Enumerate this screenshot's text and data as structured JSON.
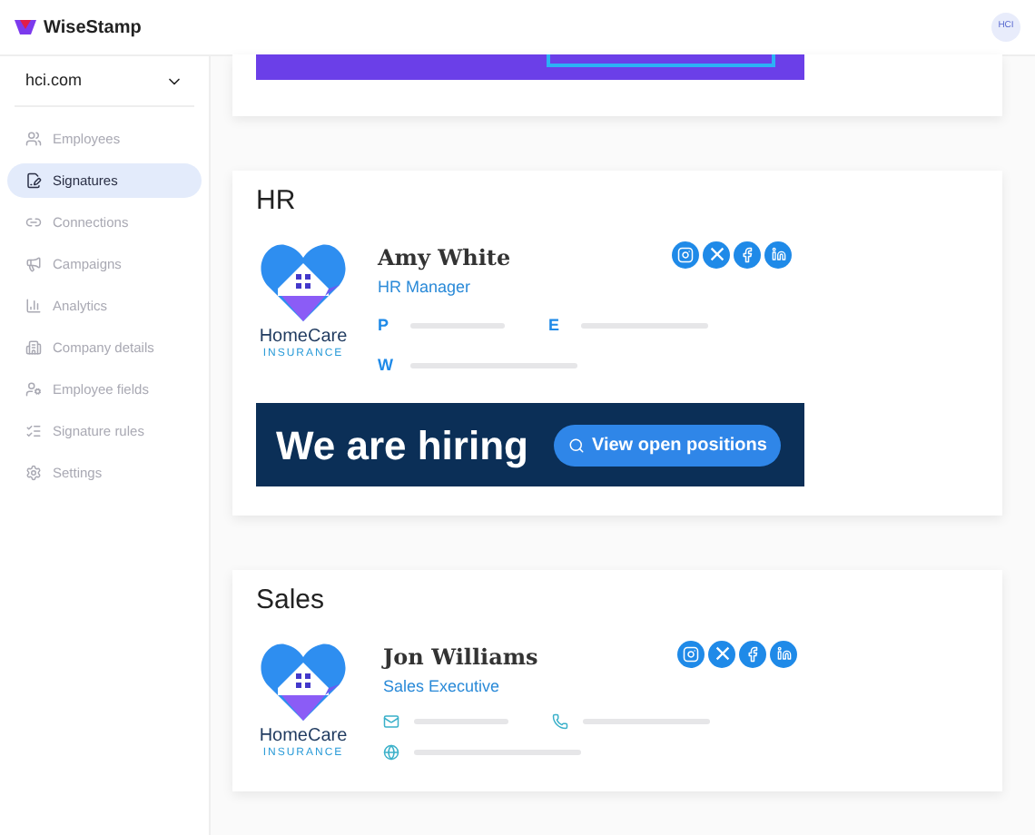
{
  "header": {
    "logo": "WiseStamp",
    "avatar": "HCI"
  },
  "sidebar": {
    "domain": "hci.com",
    "items": [
      {
        "label": "Employees",
        "selected": false,
        "disabled": true
      },
      {
        "label": "Signatures",
        "selected": true,
        "disabled": false
      },
      {
        "label": "Connections",
        "selected": false,
        "disabled": true
      },
      {
        "label": "Campaigns",
        "selected": false,
        "disabled": true
      },
      {
        "label": "Analytics",
        "selected": false,
        "disabled": true
      },
      {
        "label": "Company details",
        "selected": false,
        "disabled": true
      },
      {
        "label": "Employee fields",
        "selected": false,
        "disabled": true
      },
      {
        "label": "Signature rules",
        "selected": false,
        "disabled": true
      },
      {
        "label": "Settings",
        "selected": false,
        "disabled": true
      }
    ]
  },
  "signatures": [
    {
      "kind": "banner-only"
    },
    {
      "kind": "full",
      "title": "HR",
      "name": "Amy White",
      "role": "HR Manager",
      "logo": {
        "brand": "HomeCare",
        "tagline": "INSURANCE"
      },
      "contacts": [
        {
          "kind": "letter",
          "label": "P"
        },
        {
          "kind": "letter",
          "label": "E"
        },
        {
          "kind": "letter",
          "label": "W"
        }
      ],
      "banner": {
        "headline": "We are hiring",
        "button": "View open positions"
      }
    },
    {
      "kind": "full",
      "title": "Sales",
      "name": "Jon Williams",
      "role": "Sales Executive",
      "logo": {
        "brand": "HomeCare",
        "tagline": "INSURANCE"
      },
      "contacts": [
        {
          "kind": "mail"
        },
        {
          "kind": "phone"
        },
        {
          "kind": "web"
        }
      ]
    }
  ]
}
